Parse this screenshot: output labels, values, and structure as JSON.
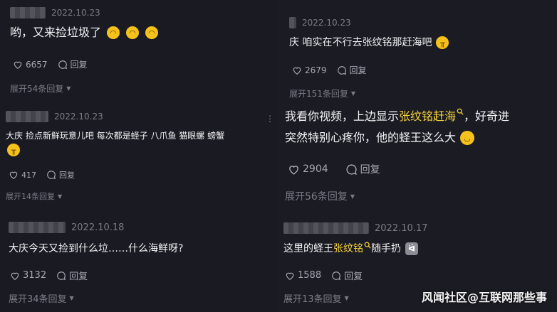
{
  "comments": [
    {
      "date": "2022.10.23",
      "text": "哟，又来捡垃圾了",
      "likes": "6657",
      "reply": "回复",
      "expand": "展开54条回复"
    },
    {
      "date": "2022.10.23",
      "text_line1": "大庆 捡点新鲜玩意儿吧 每次都是蛏子 八爪鱼 猫眼螺 螃蟹",
      "likes": "417",
      "reply": "回复",
      "expand": "展开14条回复"
    },
    {
      "date": "2022.10.18",
      "text": "大庆今天又捡到什么垃……什么海鲜呀?",
      "likes": "3132",
      "reply": "回复",
      "expand": "展开34条回复"
    },
    {
      "date": "2022.10.23",
      "text": "庆 咱实在不行去张纹铭那赶海吧",
      "likes": "2679",
      "reply": "回复",
      "expand": "展开151条回复"
    },
    {
      "text_a": "我看你视频，上边显示",
      "text_hl": "张纹铭赶海",
      "text_b": "，好奇进",
      "text_line2": "突然特别心疼你，他的蛏王这么大",
      "likes": "2904",
      "reply": "回复",
      "expand": "展开56条回复"
    },
    {
      "date": "2022.10.17",
      "text_a": "这里的蛏王",
      "text_hl": "张纹铭",
      "text_b": "随手扔",
      "likes": "1588",
      "reply": "回复",
      "expand": "展开13条回复"
    }
  ],
  "watermark": "风闻社区@互联网那些事",
  "icons": [
    "heart-icon",
    "comment-icon",
    "search-icon",
    "laugh-emoji",
    "cry-emoji",
    "cat-emoji",
    "chevron-down-icon"
  ]
}
